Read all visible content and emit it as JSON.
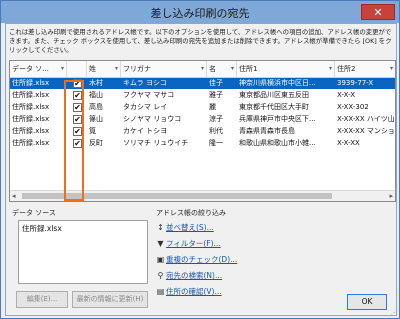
{
  "window": {
    "title": "差し込み印刷の宛先",
    "close_label": "✕"
  },
  "description": "これは差し込み印刷で使用されるアドレス帳です。以下のオプションを使用して、アドレス帳への項目の追加、アドレス帳の変更ができます。また、チェック ボックスを使用して、差し込み印刷の宛先を追加または削除できます。アドレス帳が準備できたら [OK] をクリックしてください。",
  "table": {
    "columns": [
      "データ ソ...",
      "",
      "姓",
      "フリガナ",
      "名",
      "住所1",
      "住所2"
    ],
    "rows": [
      {
        "source": "住所録.xlsx",
        "checked": "✔",
        "sei": "木村",
        "furigana": "キムラ ヨシコ",
        "mei": "佳子",
        "addr1": "神奈川県横浜市中区日...",
        "addr2": "3939-77-X"
      },
      {
        "source": "住所録.xlsx",
        "checked": "✔",
        "sei": "福山",
        "furigana": "フクヤマ マサコ",
        "mei": "雅子",
        "addr1": "東京都品川区東五反田",
        "addr2": "X-X-X"
      },
      {
        "source": "住所録.xlsx",
        "checked": "✔",
        "sei": "高島",
        "furigana": "タカシマ レイ",
        "mei": "麗",
        "addr1": "東京都千代田区大手町",
        "addr2": "X-XX-302"
      },
      {
        "source": "住所録.xlsx",
        "checked": "✔",
        "sei": "篠山",
        "furigana": "シノヤマ リョウコ",
        "mei": "涼子",
        "addr1": "兵庫県神戸市中央区下...",
        "addr2": "X-XX-XX ハイツ山田103"
      },
      {
        "source": "住所録.xlsx",
        "checked": "✔",
        "sei": "筧",
        "furigana": "カケイ トシヨ",
        "mei": "利代",
        "addr1": "青森県青森市長島",
        "addr2": "X-XX-XX マンション長島"
      },
      {
        "source": "住所録.xlsx",
        "checked": "✔",
        "sei": "反町",
        "furigana": "ソリマチ リュウイチ",
        "mei": "隆一",
        "addr1": "和歌山県和歌山市小雑...",
        "addr2": "X-X-XX"
      }
    ]
  },
  "data_source": {
    "label": "データ ソース",
    "items": [
      "住所録.xlsx"
    ],
    "edit_button": "編集(E)...",
    "refresh_button": "最新の情報に更新(H)"
  },
  "refine": {
    "label": "アドレス帳の絞り込み",
    "links": [
      {
        "icon": "↕",
        "label": "並べ替え(S)..."
      },
      {
        "icon": "▼",
        "label": "フィルター(F)..."
      },
      {
        "icon": "▣",
        "label": "重複のチェック(D)..."
      },
      {
        "icon": "⚲",
        "label": "宛先の検索(N)..."
      },
      {
        "icon": "▤",
        "label": "住所の確認(V)..."
      }
    ]
  },
  "ok_button": "OK",
  "colors": {
    "selection": "#0a64c2",
    "highlight_border": "#ec6f1a",
    "link": "#1a56b0"
  }
}
